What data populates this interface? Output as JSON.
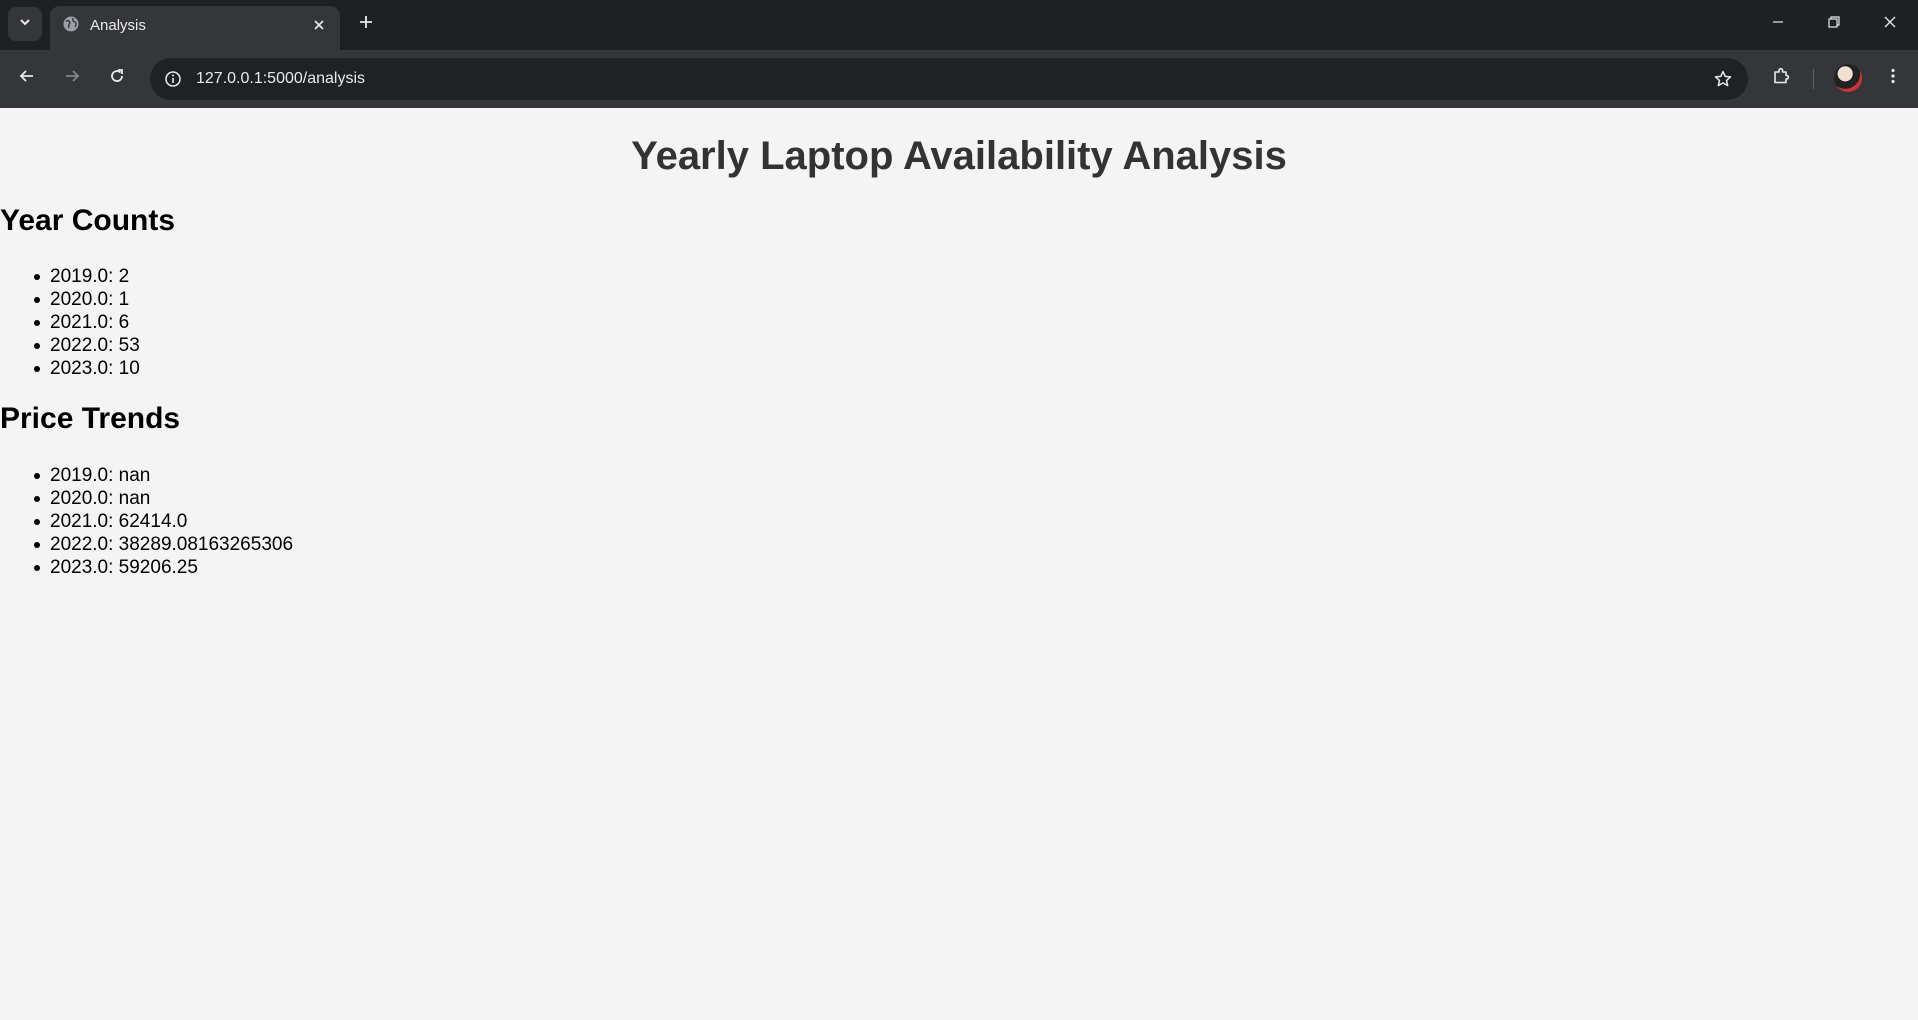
{
  "browser": {
    "tab_title": "Analysis",
    "url": "127.0.0.1:5000/analysis",
    "icons": {
      "tab_list": "chevron-down-icon",
      "favicon": "globe-icon",
      "tab_close": "close-icon",
      "new_tab": "plus-icon",
      "minimize": "minimize-icon",
      "restore": "restore-icon",
      "close_window": "close-icon",
      "back": "arrow-left-icon",
      "forward": "arrow-right-icon",
      "reload": "reload-icon",
      "site_info": "info-icon",
      "bookmark": "star-icon",
      "extensions": "puzzle-icon",
      "menu": "more-vertical-icon"
    }
  },
  "page": {
    "title": "Yearly Laptop Availability Analysis",
    "year_counts": {
      "heading": "Year Counts",
      "items": [
        "2019.0: 2",
        "2020.0: 1",
        "2021.0: 6",
        "2022.0: 53",
        "2023.0: 10"
      ]
    },
    "price_trends": {
      "heading": "Price Trends",
      "items": [
        "2019.0: nan",
        "2020.0: nan",
        "2021.0: 62414.0",
        "2022.0: 38289.08163265306",
        "2023.0: 59206.25"
      ]
    }
  },
  "colors": {
    "chrome_dark": "#1f2021",
    "chrome_toolbar": "#35363a",
    "omnibox": "#202124",
    "page_bg": "#f4f4f4",
    "title_text": "#333333"
  }
}
